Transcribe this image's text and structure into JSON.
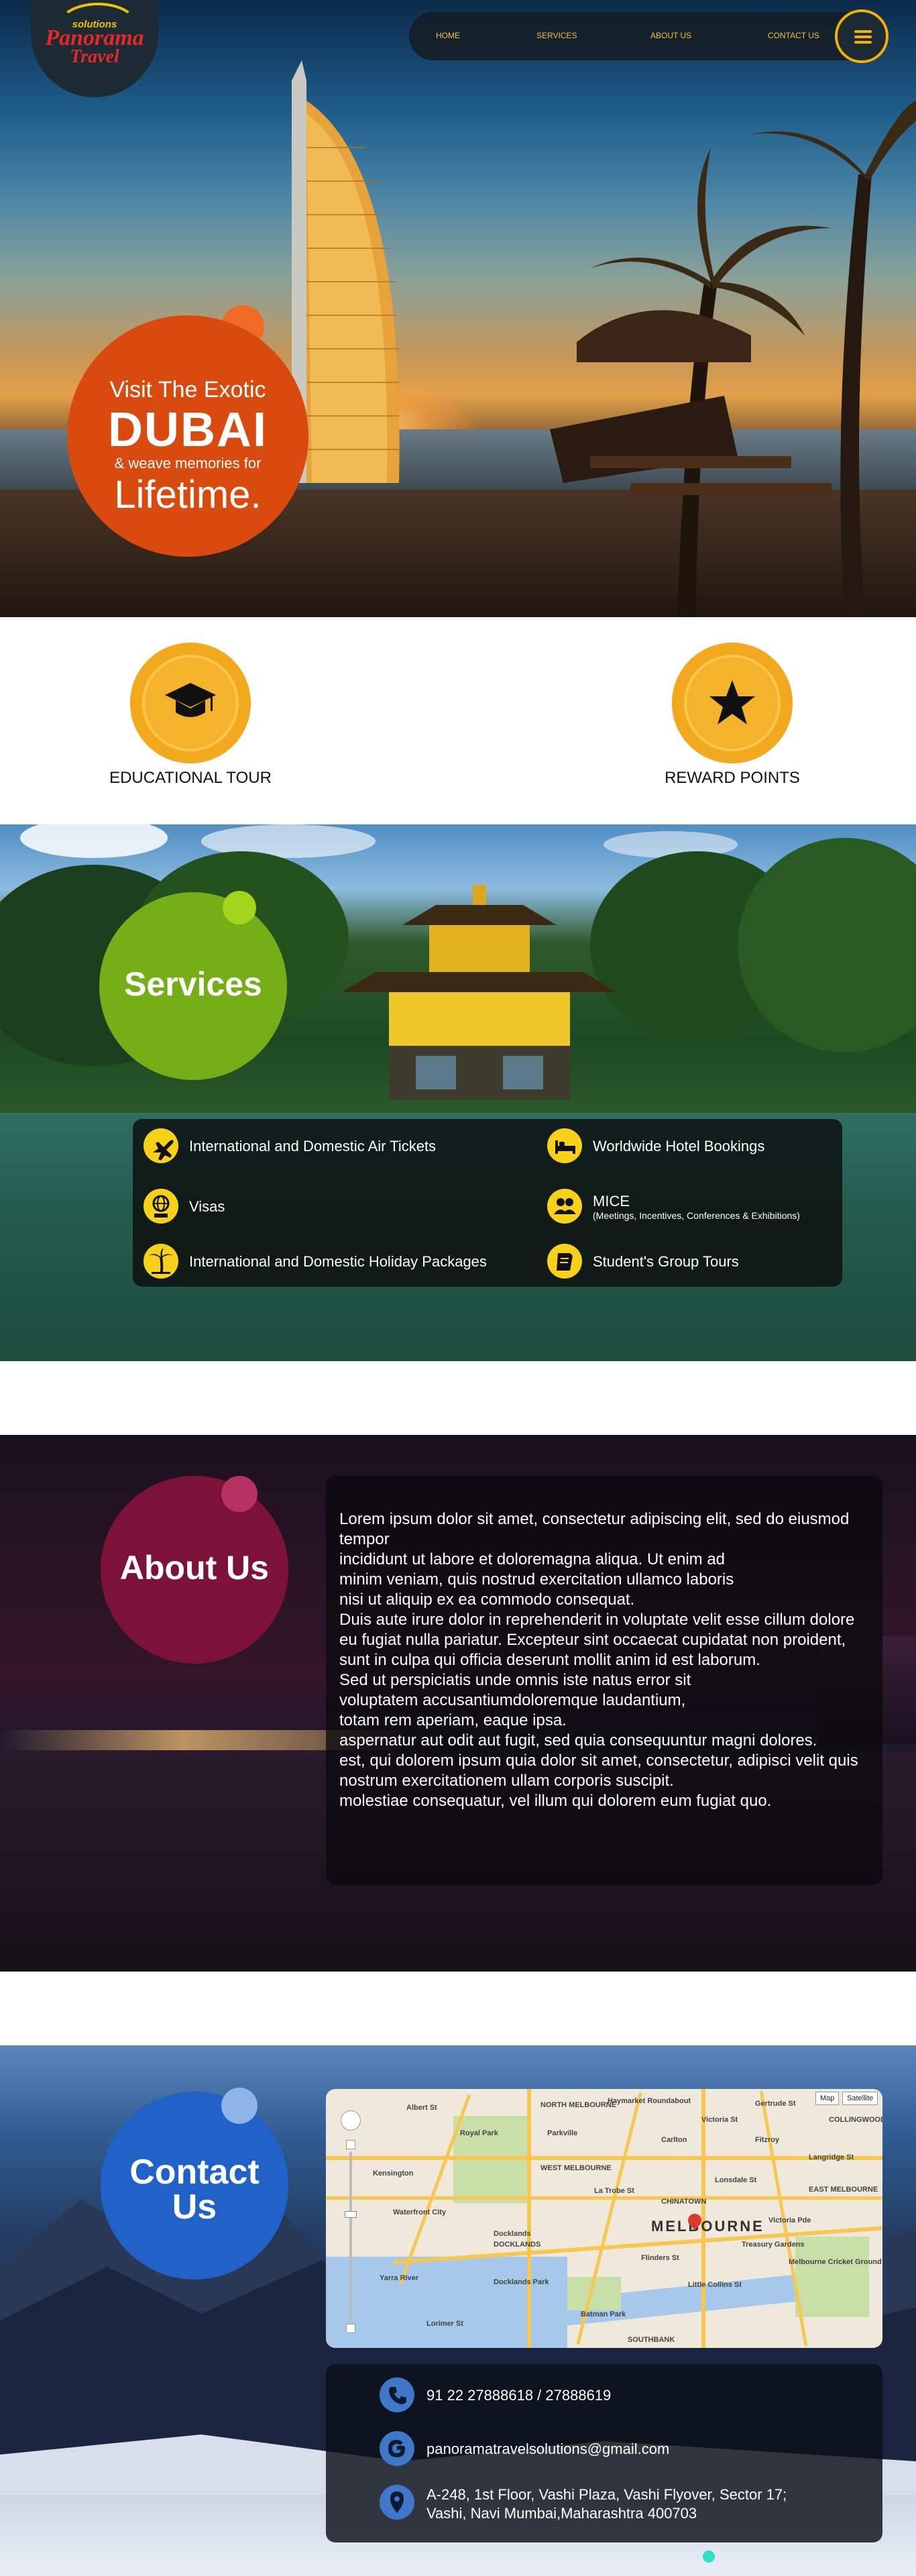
{
  "logo": {
    "top": "solutions",
    "name": "Panorama",
    "sub": "Travel"
  },
  "nav": {
    "items": [
      "HOME",
      "SERVICES",
      "ABOUT US",
      "CONTACT US"
    ]
  },
  "hero": {
    "line1": "Visit The Exotic",
    "line2": "DUBAI",
    "line3": "& weave memories for",
    "line4": "Lifetime."
  },
  "features": [
    {
      "label": "EDUCATIONAL TOUR",
      "icon": "graduation-cap-icon"
    },
    {
      "label": "REWARD POINTS",
      "icon": "star-icon"
    }
  ],
  "services": {
    "title": "Services",
    "items": [
      {
        "label": "International and Domestic Air Tickets",
        "icon": "airplane-icon"
      },
      {
        "label": "Worldwide Hotel Bookings",
        "icon": "bed-icon"
      },
      {
        "label": "Visas",
        "icon": "globe-visa-icon"
      },
      {
        "label": "MICE",
        "sub": "(Meetings, Incentives, Conferences & Exhibitions)",
        "icon": "people-icon"
      },
      {
        "label": "International and Domestic Holiday Packages",
        "icon": "palm-tree-icon"
      },
      {
        "label": "Student's Group Tours",
        "icon": "book-icon"
      }
    ]
  },
  "about": {
    "title": "About Us",
    "text": "Lorem ipsum dolor sit amet, consectetur adipiscing elit, sed do eiusmod tempor\nincididunt ut labore et doloremagna aliqua. Ut enim ad\nminim veniam, quis nostrud exercitation ullamco laboris\nnisi ut aliquip ex ea commodo consequat.\nDuis aute irure dolor in reprehenderit in voluptate velit esse cillum dolore eu fugiat nulla pariatur. Excepteur sint occaecat cupidatat non proident, sunt in culpa qui officia deserunt mollit anim id est laborum.\nSed ut perspiciatis unde omnis iste natus error sit\nvoluptatem accusantiumdoloremque laudantium,\ntotam rem aperiam, eaque ipsa.\naspernatur aut odit aut fugit, sed quia consequuntur magni dolores.\nest, qui dolorem ipsum quia dolor sit amet, consectetur, adipisci velit quis nostrum exercitationem ullam corporis suscipit.\nmolestiae consequatur, vel illum qui dolorem eum fugiat quo."
  },
  "contact": {
    "title_line1": "Contact",
    "title_line2": "Us",
    "phone": "91 22 27888618 / 27888619",
    "email": "panoramatravelsolutions@gmail.com",
    "address_line1": "A-248, 1st Floor, Vashi Plaza, Vashi Flyover, Sector 17;",
    "address_line2": "Vashi, Navi Mumbai,Maharashtra 400703"
  },
  "map": {
    "city": "MELBOURNE",
    "map_type_1": "Map",
    "map_type_2": "Satellite",
    "labels": [
      "NORTH MELBOURNE",
      "Haymarket Roundabout",
      "Parkville",
      "Royal Park",
      "Carlton",
      "WEST MELBOURNE",
      "Fitzroy",
      "COLLINGWOOD",
      "Victoria St",
      "Docklands",
      "DOCKLANDS",
      "CHINATOWN",
      "Flinders St",
      "SOUTHBANK",
      "Treasury Gardens",
      "Melbourne Cricket Ground",
      "EAST MELBOURNE",
      "Kensington",
      "Langridge St",
      "Gertrude St",
      "Albert St",
      "Lonsdale St",
      "Little Collins St",
      "Waterfront City",
      "Lorimer St",
      "Yarra River",
      "Docklands Park",
      "Batman Park",
      "La Trobe St",
      "Victoria Pde"
    ]
  },
  "colors": {
    "hero_accent": "#d94a0e",
    "services_accent": "#76ae18",
    "about_accent": "#7c1237",
    "contact_accent": "#2062c8",
    "nav_text": "#f3c330",
    "icon_yellow": "#f7d117"
  }
}
